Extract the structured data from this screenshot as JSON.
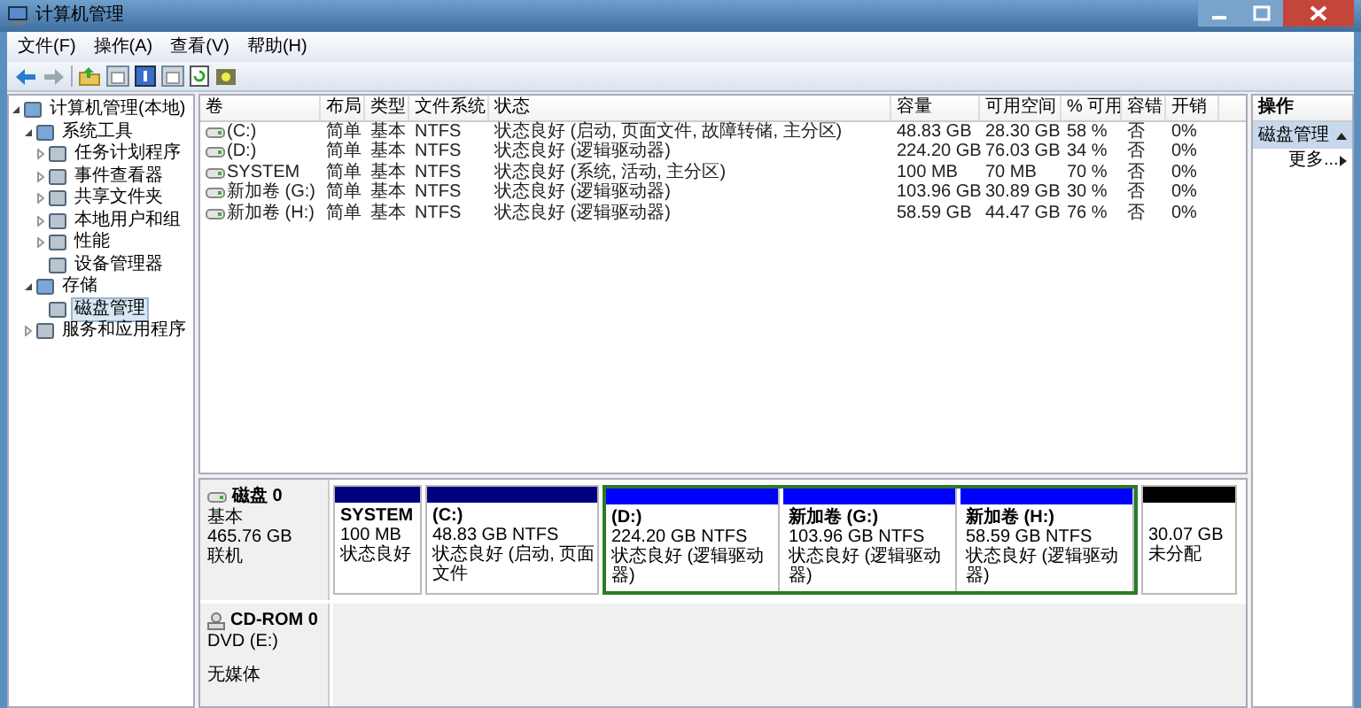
{
  "window": {
    "title": "计算机管理"
  },
  "menu": [
    {
      "label": "文件(F)"
    },
    {
      "label": "操作(A)"
    },
    {
      "label": "查看(V)"
    },
    {
      "label": "帮助(H)"
    }
  ],
  "tree": [
    {
      "label": "计算机管理(本地)",
      "expanded": true,
      "selected": false,
      "children": [
        {
          "label": "系统工具",
          "expanded": true,
          "selected": false,
          "children": [
            {
              "label": "任务计划程序",
              "expanded": false,
              "selected": false
            },
            {
              "label": "事件查看器",
              "expanded": false,
              "selected": false
            },
            {
              "label": "共享文件夹",
              "expanded": false,
              "selected": false
            },
            {
              "label": "本地用户和组",
              "expanded": false,
              "selected": false
            },
            {
              "label": "性能",
              "expanded": false,
              "selected": false
            },
            {
              "label": "设备管理器",
              "selected": false
            }
          ]
        },
        {
          "label": "存储",
          "expanded": true,
          "selected": false,
          "children": [
            {
              "label": "磁盘管理",
              "selected": true
            }
          ]
        },
        {
          "label": "服务和应用程序",
          "expanded": false,
          "selected": false
        }
      ]
    }
  ],
  "table": {
    "columns": [
      "卷",
      "布局",
      "类型",
      "文件系统",
      "状态",
      "容量",
      "可用空间",
      "% 可用",
      "容错",
      "开销"
    ],
    "rows": [
      [
        "(C:)",
        "简单",
        "基本",
        "NTFS",
        "状态良好 (启动, 页面文件, 故障转储, 主分区)",
        "48.83 GB",
        "28.30 GB",
        "58 %",
        "否",
        "0%"
      ],
      [
        "(D:)",
        "简单",
        "基本",
        "NTFS",
        "状态良好 (逻辑驱动器)",
        "224.20 GB",
        "76.03 GB",
        "34 %",
        "否",
        "0%"
      ],
      [
        "SYSTEM",
        "简单",
        "基本",
        "NTFS",
        "状态良好 (系统, 活动, 主分区)",
        "100 MB",
        "70 MB",
        "70 %",
        "否",
        "0%"
      ],
      [
        "新加卷 (G:)",
        "简单",
        "基本",
        "NTFS",
        "状态良好 (逻辑驱动器)",
        "103.96 GB",
        "30.89 GB",
        "30 %",
        "否",
        "0%"
      ],
      [
        "新加卷 (H:)",
        "简单",
        "基本",
        "NTFS",
        "状态良好 (逻辑驱动器)",
        "58.59 GB",
        "44.47 GB",
        "76 %",
        "否",
        "0%"
      ]
    ]
  },
  "disks": [
    {
      "kind": "disk",
      "name": "磁盘 0",
      "type": "基本",
      "size": "465.76 GB",
      "status": "联机",
      "partitions": [
        {
          "kind": "primary",
          "name": "SYSTEM",
          "size": "100 MB",
          "status": "状态良好"
        },
        {
          "kind": "primary",
          "name": "(C:)",
          "size": "48.83 GB NTFS",
          "status": "状态良好 (启动, 页面文件"
        },
        {
          "kind": "extended",
          "partitions": [
            {
              "kind": "logical",
              "name": "(D:)",
              "size": "224.20 GB NTFS",
              "status": "状态良好 (逻辑驱动器)"
            },
            {
              "kind": "logical",
              "name": "新加卷  (G:)",
              "size": "103.96 GB NTFS",
              "status": "状态良好 (逻辑驱动器)"
            },
            {
              "kind": "logical",
              "name": "新加卷  (H:)",
              "size": "58.59 GB NTFS",
              "status": "状态良好 (逻辑驱动器)"
            }
          ]
        },
        {
          "kind": "unallocated",
          "size": "30.07 GB",
          "status": "未分配"
        }
      ]
    },
    {
      "kind": "cdrom",
      "name": "CD-ROM 0",
      "type": "DVD (E:)",
      "status": "无媒体"
    }
  ],
  "actions": {
    "title": "操作",
    "section": "磁盘管理",
    "items": [
      "更多..."
    ]
  }
}
